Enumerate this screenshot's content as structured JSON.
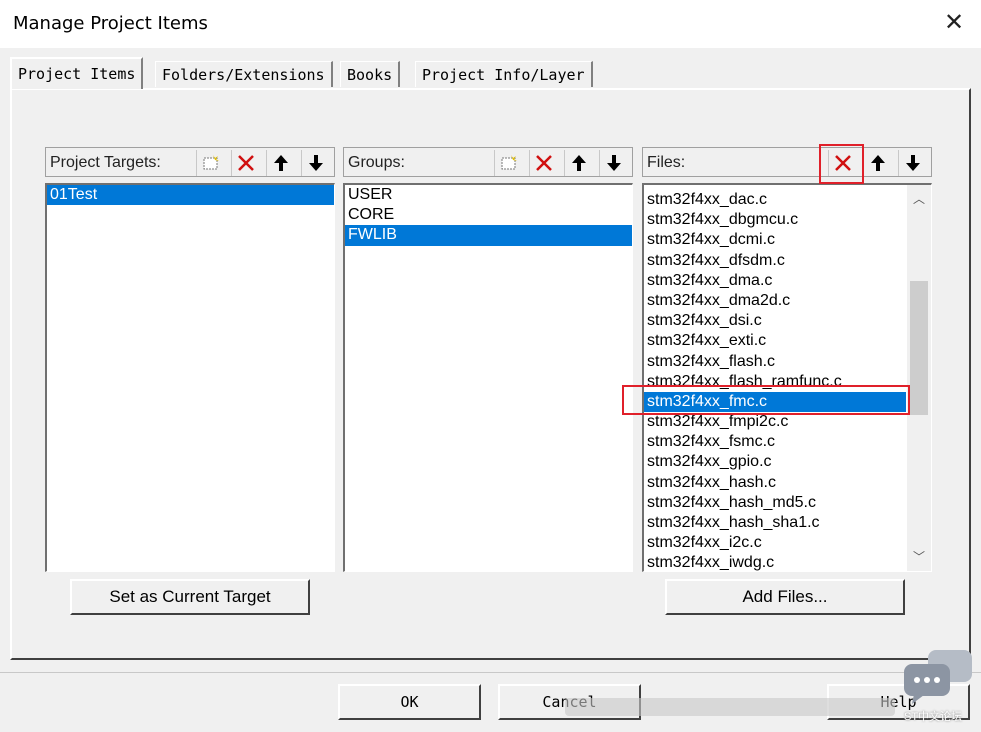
{
  "dialog": {
    "title": "Manage Project Items",
    "close_glyph": "✕"
  },
  "tabs": [
    {
      "label": "Project Items",
      "active": true
    },
    {
      "label": "Folders/Extensions",
      "active": false
    },
    {
      "label": "Books",
      "active": false
    },
    {
      "label": "Project Info/Layer",
      "active": false
    }
  ],
  "targets": {
    "label": "Project Targets:",
    "items": [
      "01Test"
    ],
    "selected": 0
  },
  "groups": {
    "label": "Groups:",
    "items": [
      "USER",
      "CORE",
      "FWLIB"
    ],
    "selected": 2
  },
  "files": {
    "label": "Files:",
    "items": [
      "stm32f4xx_dac.c",
      "stm32f4xx_dbgmcu.c",
      "stm32f4xx_dcmi.c",
      "stm32f4xx_dfsdm.c",
      "stm32f4xx_dma.c",
      "stm32f4xx_dma2d.c",
      "stm32f4xx_dsi.c",
      "stm32f4xx_exti.c",
      "stm32f4xx_flash.c",
      "stm32f4xx_flash_ramfunc.c",
      "stm32f4xx_fmc.c",
      "stm32f4xx_fmpi2c.c",
      "stm32f4xx_fsmc.c",
      "stm32f4xx_gpio.c",
      "stm32f4xx_hash.c",
      "stm32f4xx_hash_md5.c",
      "stm32f4xx_hash_sha1.c",
      "stm32f4xx_i2c.c",
      "stm32f4xx_iwdg.c"
    ],
    "selected": 10
  },
  "buttons": {
    "set_current_target": "Set as Current Target",
    "add_files": "Add Files...",
    "ok": "OK",
    "cancel": "Cancel",
    "help": "Help"
  },
  "watermark": {
    "text": "ST中文论坛"
  },
  "colors": {
    "selection": "#0078d7",
    "highlight_box": "#e0202a",
    "delete_icon": "#d01010"
  }
}
